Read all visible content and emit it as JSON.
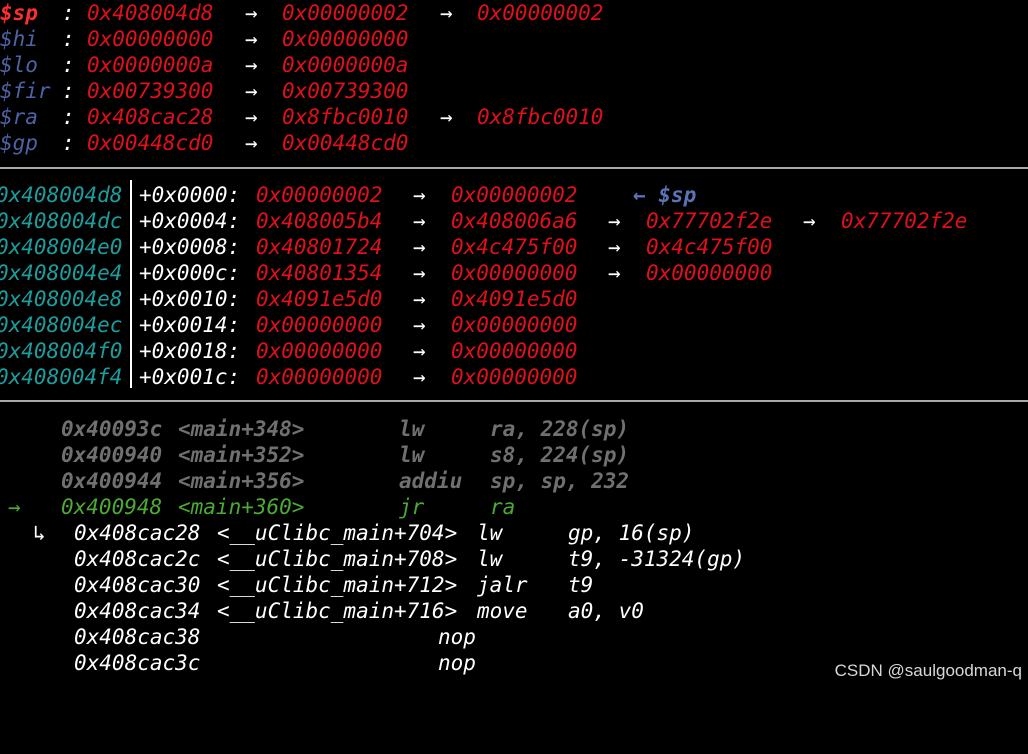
{
  "registers": [
    {
      "name": "$sp",
      "colon": ":",
      "chain": [
        "0x408004d8",
        "0x00000002",
        "0x00000002"
      ],
      "highlight": true
    },
    {
      "name": "$hi",
      "colon": ":",
      "chain": [
        "0x00000000",
        "0x00000000"
      ],
      "highlight": false
    },
    {
      "name": "$lo",
      "colon": ":",
      "chain": [
        "0x0000000a",
        "0x0000000a"
      ],
      "highlight": false
    },
    {
      "name": "$fir",
      "colon": ":",
      "chain": [
        "0x00739300",
        "0x00739300"
      ],
      "highlight": false
    },
    {
      "name": "$ra",
      "colon": ":",
      "chain": [
        "0x408cac28",
        "0x8fbc0010",
        "0x8fbc0010"
      ],
      "highlight": false
    },
    {
      "name": "$gp",
      "colon": ":",
      "chain": [
        "0x00448cd0",
        "0x00448cd0"
      ],
      "highlight": false
    }
  ],
  "arrow_glyph": "→",
  "stack": [
    {
      "addr": "0x408004d8",
      "offset": "+0x0000:",
      "chain": [
        "0x00000002",
        "0x00000002"
      ],
      "tag": "← $sp"
    },
    {
      "addr": "0x408004dc",
      "offset": "+0x0004:",
      "chain": [
        "0x408005b4",
        "0x408006a6",
        "0x77702f2e",
        "0x77702f2e"
      ],
      "tag": ""
    },
    {
      "addr": "0x408004e0",
      "offset": "+0x0008:",
      "chain": [
        "0x40801724",
        "0x4c475f00",
        "0x4c475f00"
      ],
      "tag": ""
    },
    {
      "addr": "0x408004e4",
      "offset": "+0x000c:",
      "chain": [
        "0x40801354",
        "0x00000000",
        "0x00000000"
      ],
      "tag": ""
    },
    {
      "addr": "0x408004e8",
      "offset": "+0x0010:",
      "chain": [
        "0x4091e5d0",
        "0x4091e5d0"
      ],
      "tag": ""
    },
    {
      "addr": "0x408004ec",
      "offset": "+0x0014:",
      "chain": [
        "0x00000000",
        "0x00000000"
      ],
      "tag": ""
    },
    {
      "addr": "0x408004f0",
      "offset": "+0x0018:",
      "chain": [
        "0x00000000",
        "0x00000000"
      ],
      "tag": ""
    },
    {
      "addr": "0x408004f4",
      "offset": "+0x001c:",
      "chain": [
        "0x00000000",
        "0x00000000"
      ],
      "tag": ""
    }
  ],
  "code_past": [
    {
      "addr": "0x40093c",
      "sym": "<main+348>",
      "op": "lw",
      "args": "ra, 228(sp)"
    },
    {
      "addr": "0x400940",
      "sym": "<main+352>",
      "op": "lw",
      "args": "s8, 224(sp)"
    },
    {
      "addr": "0x400944",
      "sym": "<main+356>",
      "op": "addiu",
      "args": "sp, sp, 232"
    }
  ],
  "code_current": {
    "marker": "→",
    "addr": "0x400948",
    "sym": "<main+360>",
    "op": "jr",
    "args": "ra"
  },
  "code_branch": [
    {
      "marker": "↳",
      "addr": "0x408cac28",
      "sym": "<__uClibc_main+704>",
      "op": "lw",
      "args": "gp, 16(sp)"
    },
    {
      "marker": "",
      "addr": "0x408cac2c",
      "sym": "<__uClibc_main+708>",
      "op": "lw",
      "args": "t9, -31324(gp)"
    },
    {
      "marker": "",
      "addr": "0x408cac30",
      "sym": "<__uClibc_main+712>",
      "op": "jalr",
      "args": "t9"
    },
    {
      "marker": "",
      "addr": "0x408cac34",
      "sym": "<__uClibc_main+716>",
      "op": "move",
      "args": "a0, v0"
    },
    {
      "marker": "",
      "addr": "0x408cac38",
      "sym": "",
      "op": "nop",
      "args": ""
    },
    {
      "marker": "",
      "addr": "0x408cac3c",
      "sym": "",
      "op": "nop",
      "args": ""
    }
  ],
  "watermark": "CSDN @saulgoodman-q"
}
